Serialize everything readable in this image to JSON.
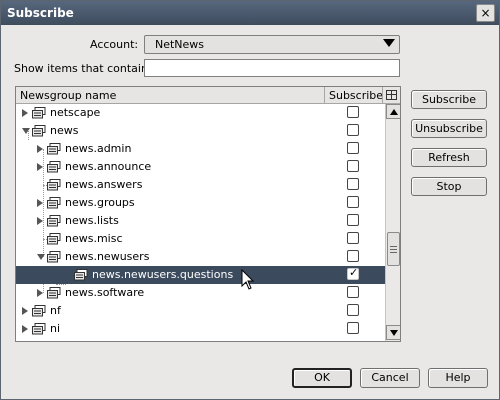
{
  "window": {
    "title": "Subscribe",
    "close_glyph": "×"
  },
  "form": {
    "account_label": "Account:",
    "account_value": "NetNews",
    "filter_label": "Show items that contain:",
    "filter_value": ""
  },
  "tree": {
    "columns": {
      "name": "Newsgroup name",
      "subscribe": "Subscribe"
    },
    "rows": [
      {
        "label": "netscape",
        "twisty": "closed",
        "checked": false
      },
      {
        "label": "news",
        "twisty": "open",
        "checked": false
      },
      {
        "label": "news.admin",
        "twisty": "closed",
        "checked": false
      },
      {
        "label": "news.announce",
        "twisty": "closed",
        "checked": false
      },
      {
        "label": "news.answers",
        "twisty": "none",
        "checked": false
      },
      {
        "label": "news.groups",
        "twisty": "closed",
        "checked": false
      },
      {
        "label": "news.lists",
        "twisty": "closed",
        "checked": false
      },
      {
        "label": "news.misc",
        "twisty": "none",
        "checked": false
      },
      {
        "label": "news.newusers",
        "twisty": "open",
        "checked": false
      },
      {
        "label": "news.newusers.questions",
        "twisty": "none",
        "checked": true,
        "selected": true
      },
      {
        "label": "news.software",
        "twisty": "closed",
        "checked": false
      },
      {
        "label": "nf",
        "twisty": "closed",
        "checked": false
      },
      {
        "label": "ni",
        "twisty": "closed",
        "checked": false
      }
    ]
  },
  "actions": {
    "subscribe": "Subscribe",
    "unsubscribe": "Unsubscribe",
    "refresh": "Refresh",
    "stop": "Stop"
  },
  "footer": {
    "ok": "OK",
    "cancel": "Cancel",
    "help": "Help"
  },
  "icons": {
    "folder": "newsgroup-folder-icon",
    "cursor": "mouse-pointer-icon",
    "column_picker": "column-picker-icon"
  },
  "colors": {
    "titlebar": "#4b5a6f",
    "selection": "#3c4a5e",
    "window_bg": "#e9e8e6"
  }
}
